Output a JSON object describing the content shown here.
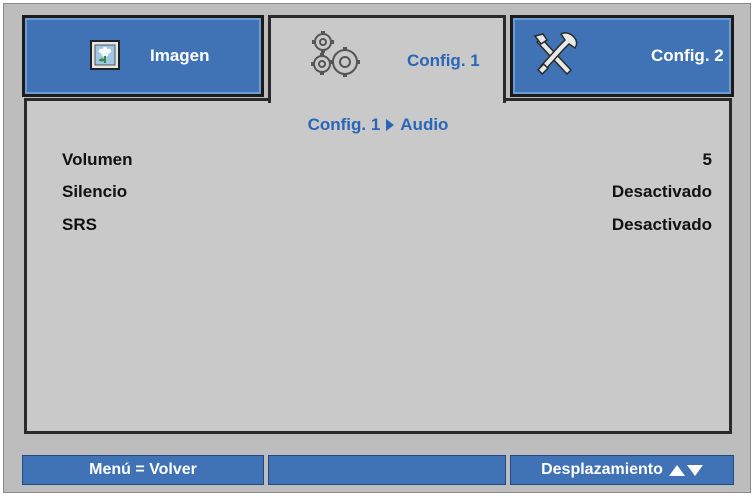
{
  "tabs": [
    {
      "label": "Imagen",
      "icon": "picture-icon",
      "active": false
    },
    {
      "label": "Config. 1",
      "icon": "gears-icon",
      "active": true
    },
    {
      "label": "Config. 2",
      "icon": "tools-icon",
      "active": false
    }
  ],
  "breadcrumb": {
    "parent": "Config. 1",
    "current": "Audio"
  },
  "settings": [
    {
      "label": "Volumen",
      "value": "5"
    },
    {
      "label": "Silencio",
      "value": "Desactivado"
    },
    {
      "label": "SRS",
      "value": "Desactivado"
    }
  ],
  "footer": {
    "left": "Menú = Volver",
    "middle": "",
    "right": "Desplazamiento"
  },
  "colors": {
    "accent": "#3f73b6",
    "highlight_text": "#2a66b7",
    "panel": "#c9c9c9",
    "frame": "#bdbdbd"
  }
}
